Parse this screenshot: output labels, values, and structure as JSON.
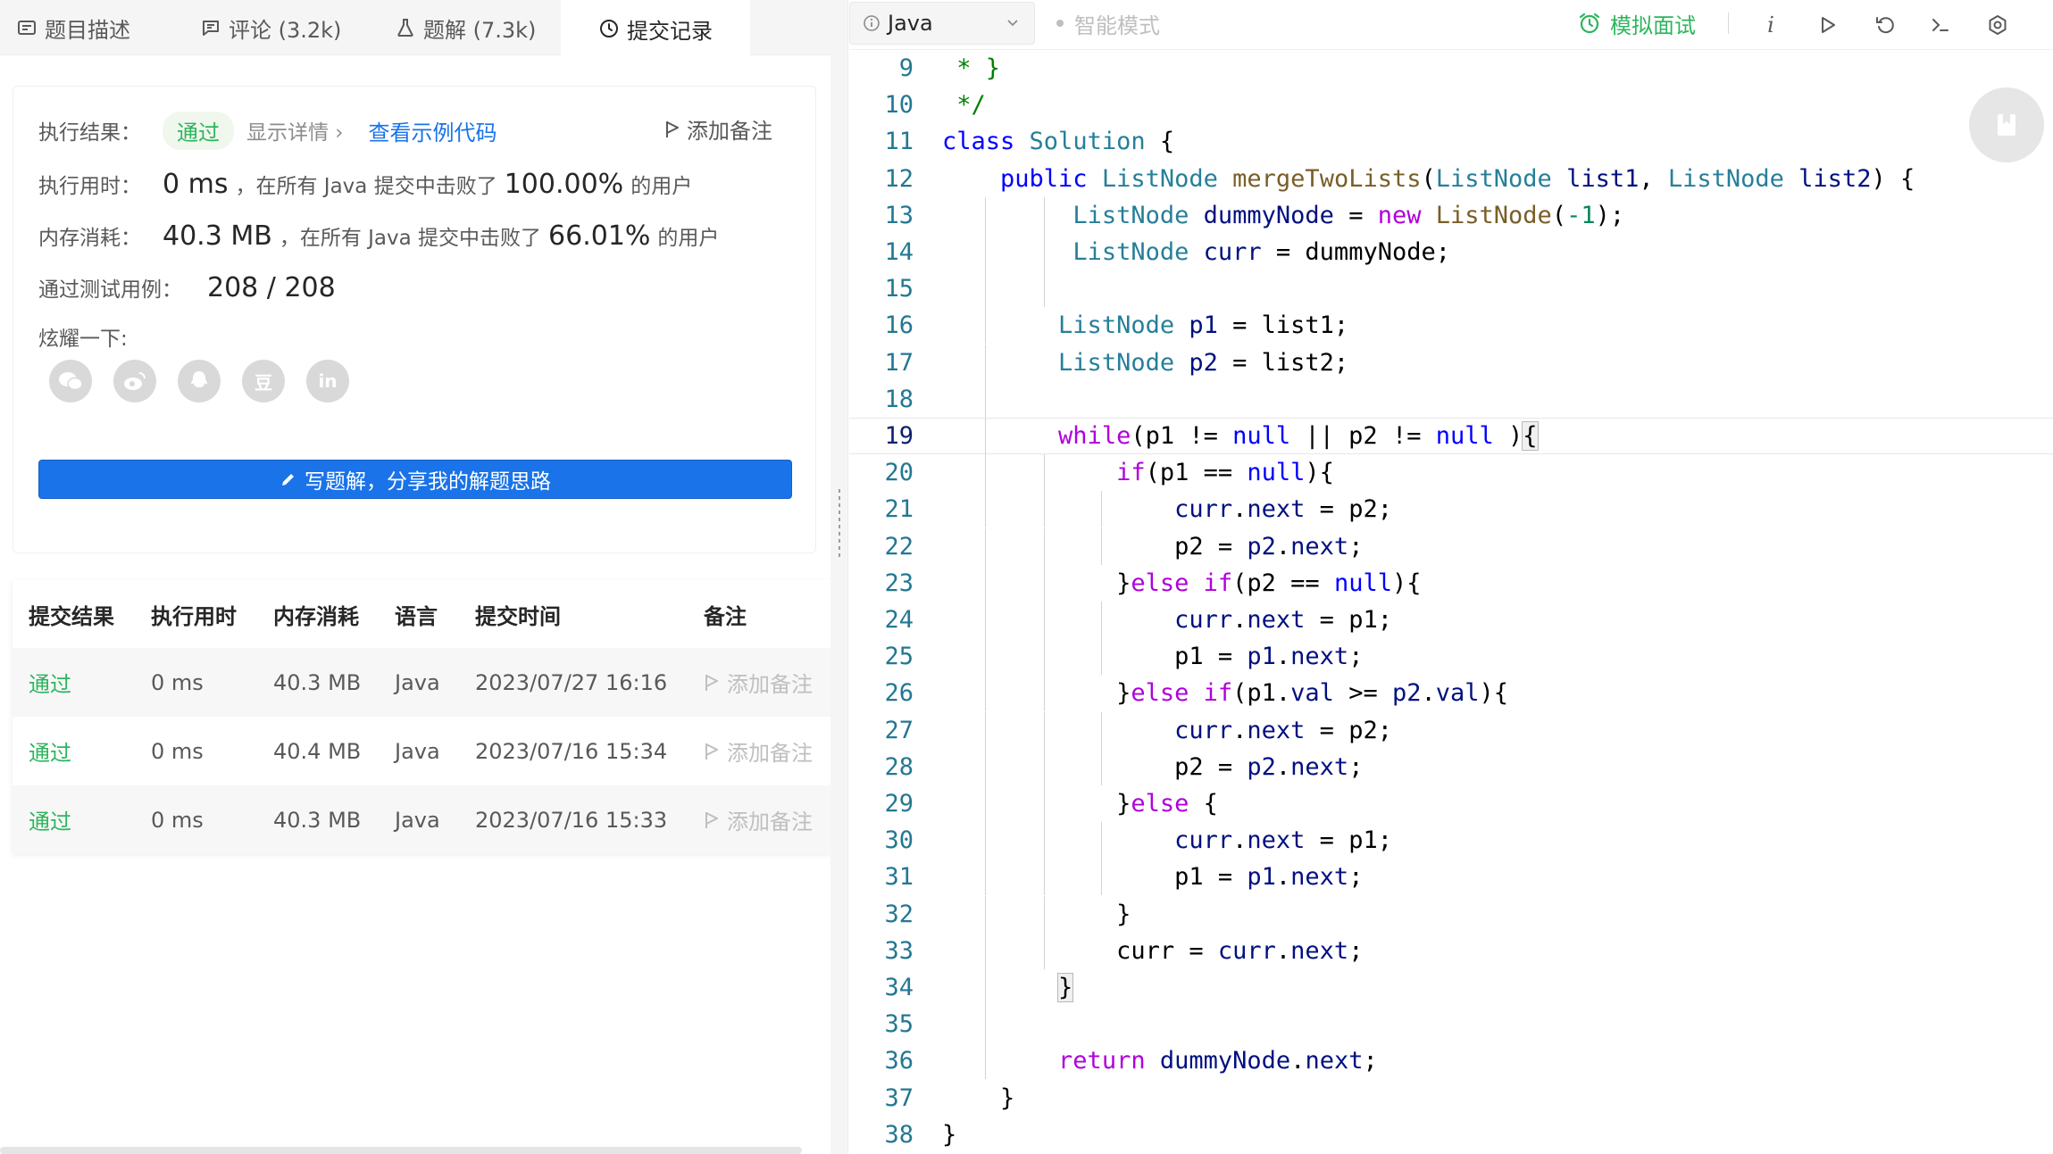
{
  "tabs": [
    {
      "label": "题目描述",
      "icon": "description-icon"
    },
    {
      "label": "评论 (3.2k)",
      "icon": "comment-icon"
    },
    {
      "label": "题解 (7.3k)",
      "icon": "flask-icon"
    },
    {
      "label": "提交记录",
      "icon": "clock-icon",
      "active": true
    }
  ],
  "result": {
    "status_label": "执行结果：",
    "status": "通过",
    "show_detail": "显示详情 ›",
    "example_code": "查看示例代码",
    "add_note": "添加备注",
    "time_label": "执行用时：",
    "time_value": "0 ms",
    "time_mid": "，在所有 Java 提交中击败了",
    "time_pct": "100.00%",
    "time_tail": "的用户",
    "mem_label": "内存消耗：",
    "mem_value": "40.3 MB",
    "mem_mid": "，在所有 Java 提交中击败了",
    "mem_pct": "66.01%",
    "mem_tail": "的用户",
    "tests_label": "通过测试用例：",
    "tests_value": "208 / 208",
    "share_label": "炫耀一下:",
    "share_icons": [
      "wechat-icon",
      "weibo-icon",
      "qq-icon",
      "douban-icon",
      "linkedin-icon"
    ],
    "share_glyphs": [
      "",
      "",
      "",
      "豆",
      "in"
    ],
    "write_solution": "写题解，分享我的解题思路"
  },
  "submissions": {
    "headers": [
      "提交结果",
      "执行用时",
      "内存消耗",
      "语言",
      "提交时间",
      "备注"
    ],
    "rows": [
      {
        "status": "通过",
        "time": "0 ms",
        "memory": "40.3 MB",
        "lang": "Java",
        "date": "2023/07/27 16:16",
        "note": "添加备注"
      },
      {
        "status": "通过",
        "time": "0 ms",
        "memory": "40.4 MB",
        "lang": "Java",
        "date": "2023/07/16 15:34",
        "note": "添加备注"
      },
      {
        "status": "通过",
        "time": "0 ms",
        "memory": "40.3 MB",
        "lang": "Java",
        "date": "2023/07/16 15:33",
        "note": "添加备注"
      }
    ]
  },
  "toolbar": {
    "language": "Java",
    "smart_mode": "智能模式",
    "mock_interview": "模拟面试",
    "info_glyph": "i"
  },
  "editor": {
    "current_line": 19,
    "lines": [
      {
        "n": 9,
        "guides": 0,
        "tokens": [
          [
            "cm",
            " * }"
          ]
        ]
      },
      {
        "n": 10,
        "guides": 0,
        "tokens": [
          [
            "cm",
            " */"
          ]
        ]
      },
      {
        "n": 11,
        "guides": 0,
        "tokens": [
          [
            "kw",
            "class"
          ],
          [
            "",
            " "
          ],
          [
            "ty",
            "Solution"
          ],
          [
            "",
            " {"
          ]
        ]
      },
      {
        "n": 12,
        "guides": 0,
        "tokens": [
          [
            "",
            "    "
          ],
          [
            "kw",
            "public"
          ],
          [
            "",
            " "
          ],
          [
            "ty",
            "ListNode"
          ],
          [
            "",
            " "
          ],
          [
            "fn",
            "mergeTwoLists"
          ],
          [
            "",
            "("
          ],
          [
            "ty",
            "ListNode"
          ],
          [
            "",
            " "
          ],
          [
            "var",
            "list1"
          ],
          [
            "",
            ", "
          ],
          [
            "ty",
            "ListNode"
          ],
          [
            "",
            " "
          ],
          [
            "var",
            "list2"
          ],
          [
            "",
            ") {"
          ]
        ]
      },
      {
        "n": 13,
        "guides": 2,
        "tokens": [
          [
            "",
            "         "
          ],
          [
            "ty",
            "ListNode"
          ],
          [
            "",
            " "
          ],
          [
            "var",
            "dummyNode"
          ],
          [
            "",
            " = "
          ],
          [
            "kw2",
            "new"
          ],
          [
            "",
            " "
          ],
          [
            "fn",
            "ListNode"
          ],
          [
            "",
            "("
          ],
          [
            "num",
            "-1"
          ],
          [
            "",
            ");"
          ]
        ]
      },
      {
        "n": 14,
        "guides": 2,
        "tokens": [
          [
            "",
            "         "
          ],
          [
            "ty",
            "ListNode"
          ],
          [
            "",
            " "
          ],
          [
            "var",
            "curr"
          ],
          [
            "",
            " = dummyNode;"
          ]
        ]
      },
      {
        "n": 15,
        "guides": 2,
        "tokens": []
      },
      {
        "n": 16,
        "guides": 1,
        "tokens": [
          [
            "",
            "        "
          ],
          [
            "ty",
            "ListNode"
          ],
          [
            "",
            " "
          ],
          [
            "var",
            "p1"
          ],
          [
            "",
            " = list1;"
          ]
        ]
      },
      {
        "n": 17,
        "guides": 1,
        "tokens": [
          [
            "",
            "        "
          ],
          [
            "ty",
            "ListNode"
          ],
          [
            "",
            " "
          ],
          [
            "var",
            "p2"
          ],
          [
            "",
            " = list2;"
          ]
        ]
      },
      {
        "n": 18,
        "guides": 1,
        "tokens": []
      },
      {
        "n": 19,
        "guides": 1,
        "tokens": [
          [
            "",
            "        "
          ],
          [
            "kw2",
            "while"
          ],
          [
            "",
            "(p1 != "
          ],
          [
            "kw",
            "null"
          ],
          [
            "",
            " || p2 != "
          ],
          [
            "kw",
            "null"
          ],
          [
            "",
            " )"
          ],
          [
            "hl",
            "{"
          ]
        ]
      },
      {
        "n": 20,
        "guides": 2,
        "tokens": [
          [
            "",
            "            "
          ],
          [
            "kw2",
            "if"
          ],
          [
            "",
            "(p1 == "
          ],
          [
            "kw",
            "null"
          ],
          [
            "",
            "){"
          ]
        ]
      },
      {
        "n": 21,
        "guides": 3,
        "tokens": [
          [
            "",
            "                "
          ],
          [
            "var",
            "curr"
          ],
          [
            "",
            "."
          ],
          [
            "var",
            "next"
          ],
          [
            "",
            " = p2;"
          ]
        ]
      },
      {
        "n": 22,
        "guides": 3,
        "tokens": [
          [
            "",
            "                p2 = "
          ],
          [
            "var",
            "p2"
          ],
          [
            "",
            "."
          ],
          [
            "var",
            "next"
          ],
          [
            "",
            ";"
          ]
        ]
      },
      {
        "n": 23,
        "guides": 2,
        "tokens": [
          [
            "",
            "            }"
          ],
          [
            "kw2",
            "else"
          ],
          [
            "",
            " "
          ],
          [
            "kw2",
            "if"
          ],
          [
            "",
            "(p2 == "
          ],
          [
            "kw",
            "null"
          ],
          [
            "",
            "){"
          ]
        ]
      },
      {
        "n": 24,
        "guides": 3,
        "tokens": [
          [
            "",
            "                "
          ],
          [
            "var",
            "curr"
          ],
          [
            "",
            "."
          ],
          [
            "var",
            "next"
          ],
          [
            "",
            " = p1;"
          ]
        ]
      },
      {
        "n": 25,
        "guides": 3,
        "tokens": [
          [
            "",
            "                p1 = "
          ],
          [
            "var",
            "p1"
          ],
          [
            "",
            "."
          ],
          [
            "var",
            "next"
          ],
          [
            "",
            ";"
          ]
        ]
      },
      {
        "n": 26,
        "guides": 2,
        "tokens": [
          [
            "",
            "            }"
          ],
          [
            "kw2",
            "else"
          ],
          [
            "",
            " "
          ],
          [
            "kw2",
            "if"
          ],
          [
            "",
            "(p1."
          ],
          [
            "var",
            "val"
          ],
          [
            "",
            " >= "
          ],
          [
            "var",
            "p2"
          ],
          [
            "",
            "."
          ],
          [
            "var",
            "val"
          ],
          [
            "",
            "){"
          ]
        ]
      },
      {
        "n": 27,
        "guides": 3,
        "tokens": [
          [
            "",
            "                "
          ],
          [
            "var",
            "curr"
          ],
          [
            "",
            "."
          ],
          [
            "var",
            "next"
          ],
          [
            "",
            " = p2;"
          ]
        ]
      },
      {
        "n": 28,
        "guides": 3,
        "tokens": [
          [
            "",
            "                p2 = "
          ],
          [
            "var",
            "p2"
          ],
          [
            "",
            "."
          ],
          [
            "var",
            "next"
          ],
          [
            "",
            ";"
          ]
        ]
      },
      {
        "n": 29,
        "guides": 2,
        "tokens": [
          [
            "",
            "            }"
          ],
          [
            "kw2",
            "else"
          ],
          [
            "",
            " {"
          ]
        ]
      },
      {
        "n": 30,
        "guides": 3,
        "tokens": [
          [
            "",
            "                "
          ],
          [
            "var",
            "curr"
          ],
          [
            "",
            "."
          ],
          [
            "var",
            "next"
          ],
          [
            "",
            " = p1;"
          ]
        ]
      },
      {
        "n": 31,
        "guides": 3,
        "tokens": [
          [
            "",
            "                p1 = "
          ],
          [
            "var",
            "p1"
          ],
          [
            "",
            "."
          ],
          [
            "var",
            "next"
          ],
          [
            "",
            ";"
          ]
        ]
      },
      {
        "n": 32,
        "guides": 2,
        "tokens": [
          [
            "",
            "            }"
          ]
        ]
      },
      {
        "n": 33,
        "guides": 2,
        "tokens": [
          [
            "",
            "            curr = "
          ],
          [
            "var",
            "curr"
          ],
          [
            "",
            "."
          ],
          [
            "var",
            "next"
          ],
          [
            "",
            ";"
          ]
        ]
      },
      {
        "n": 34,
        "guides": 1,
        "tokens": [
          [
            "",
            "        "
          ],
          [
            "hl",
            "}"
          ]
        ]
      },
      {
        "n": 35,
        "guides": 1,
        "tokens": []
      },
      {
        "n": 36,
        "guides": 1,
        "tokens": [
          [
            "",
            "        "
          ],
          [
            "kw2",
            "return"
          ],
          [
            "",
            " "
          ],
          [
            "var",
            "dummyNode"
          ],
          [
            "",
            "."
          ],
          [
            "var",
            "next"
          ],
          [
            "",
            ";"
          ]
        ]
      },
      {
        "n": 37,
        "guides": 0,
        "tokens": [
          [
            "",
            "    }"
          ]
        ]
      },
      {
        "n": 38,
        "guides": 0,
        "tokens": [
          [
            "",
            "}"
          ]
        ]
      }
    ]
  },
  "colors": {
    "accent_blue": "#1a73e8",
    "pass_green": "#2db55d",
    "keyword_blue": "#0000ff",
    "keyword_purple": "#af00db",
    "type_teal": "#267f99",
    "comment_green": "#008000"
  }
}
